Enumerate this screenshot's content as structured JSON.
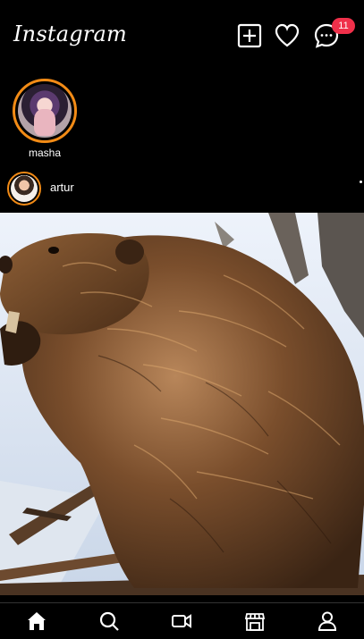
{
  "app": {
    "logo_text": "Instagram"
  },
  "header": {
    "icons": [
      "new-post-icon",
      "heart-icon",
      "messages-icon"
    ],
    "messages_badge": "11"
  },
  "stories": [
    {
      "username": "masha"
    }
  ],
  "post": {
    "username": "artur",
    "image_subject": "beaver in snow"
  },
  "bottom_nav": {
    "items": [
      "home-icon",
      "search-icon",
      "video-icon",
      "shop-icon",
      "profile-icon"
    ],
    "active": "home-icon"
  },
  "colors": {
    "story_ring": "#f28b16",
    "badge": "#f0304a",
    "background": "#000000"
  }
}
